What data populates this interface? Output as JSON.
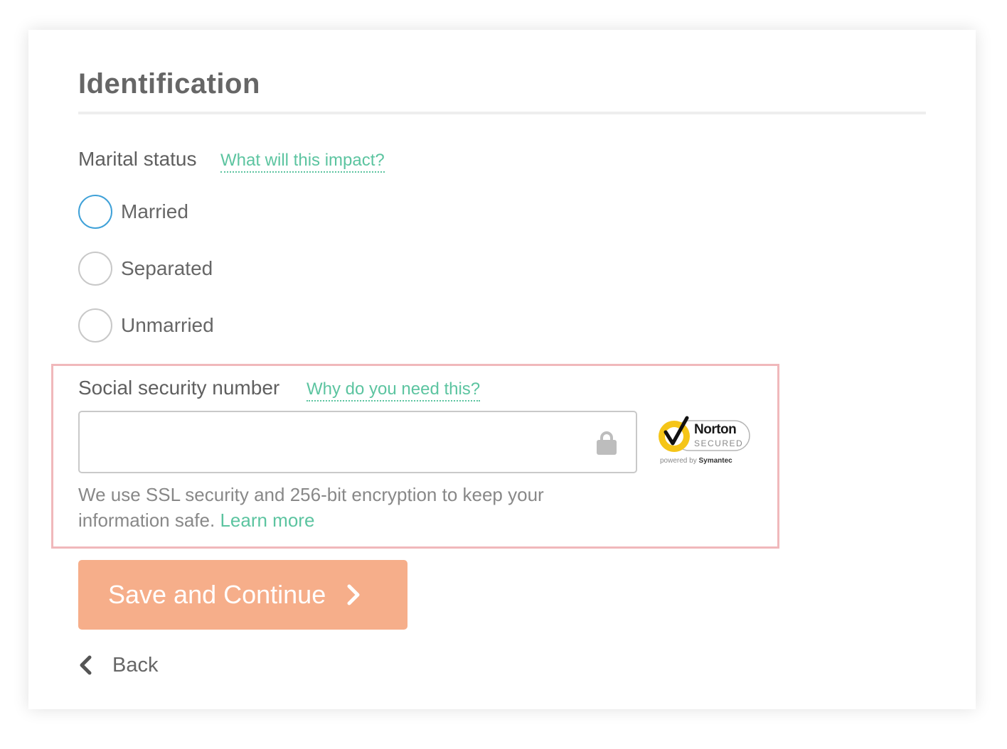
{
  "section": {
    "title": "Identification"
  },
  "marital": {
    "label": "Marital status",
    "help_link": "What will this impact?",
    "options": [
      {
        "label": "Married",
        "focused": true
      },
      {
        "label": "Separated",
        "focused": false
      },
      {
        "label": "Unmarried",
        "focused": false
      }
    ]
  },
  "ssn": {
    "label": "Social security number",
    "help_link": "Why do you need this?",
    "value": "",
    "help_text": "We use SSL security and 256-bit encryption to keep your information safe.",
    "learn_more": "Learn more",
    "input_icon": "lock-icon"
  },
  "badge": {
    "brand": "Norton",
    "secured": "SECURED",
    "powered_prefix": "powered by",
    "powered_brand": "Symantec",
    "icon": "checkmark-icon"
  },
  "actions": {
    "save_label": "Save and Continue",
    "save_icon": "chevron-right-icon",
    "back_label": "Back",
    "back_icon": "chevron-left-icon"
  },
  "colors": {
    "accent_link": "#5cc4a0",
    "primary_button": "#f6ae8a",
    "focus_ring": "#3fa1d8",
    "highlight_border": "#f0b8bb",
    "norton_yellow": "#f5c518"
  }
}
